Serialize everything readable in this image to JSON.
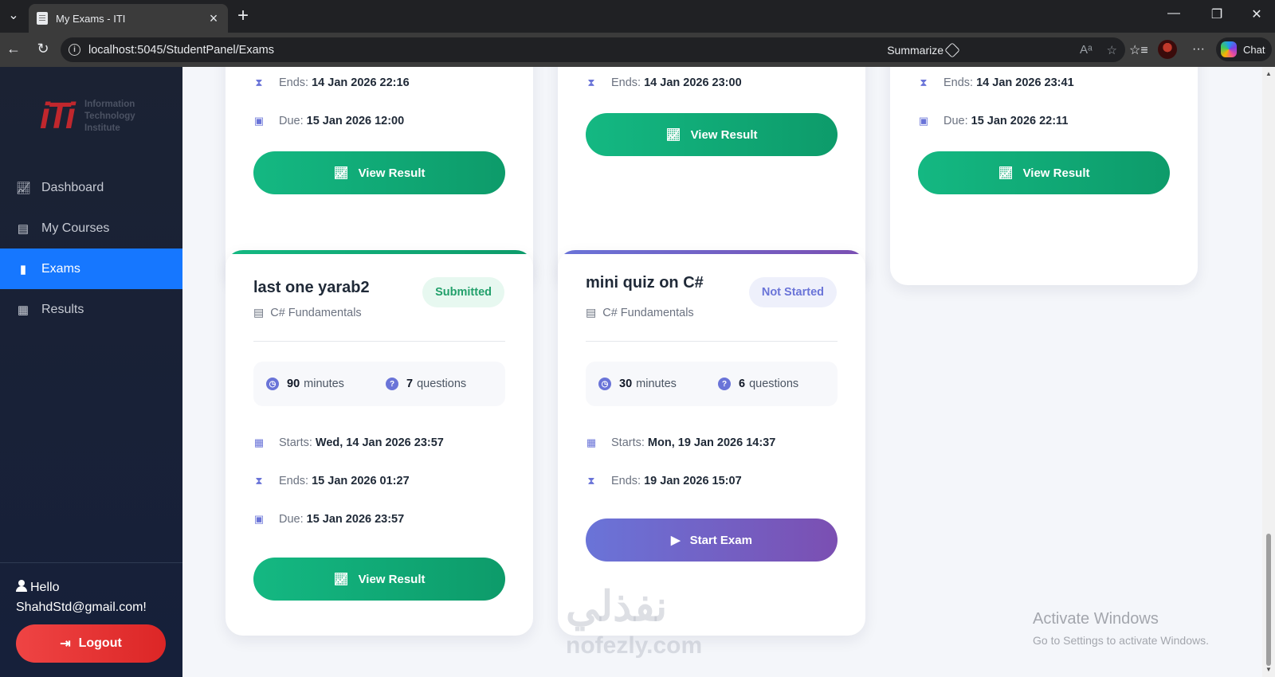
{
  "browser": {
    "tab_title": "My Exams - ITI",
    "url": "localhost:5045/StudentPanel/Exams",
    "summarize_label": "Summarize",
    "chat_label": "Chat"
  },
  "sidebar": {
    "logo_text": [
      "Information",
      "Technology",
      "Institute"
    ],
    "items": [
      {
        "label": "Dashboard",
        "icon": "chart-line-icon"
      },
      {
        "label": "My Courses",
        "icon": "book-icon"
      },
      {
        "label": "Exams",
        "icon": "file-icon",
        "active": true
      },
      {
        "label": "Results",
        "icon": "bar-chart-icon"
      }
    ],
    "greeting": "Hello",
    "email": "ShahdStd@gmail.com!",
    "logout_label": "Logout"
  },
  "top_cards": [
    {
      "ends_label": "Ends:",
      "ends": "14 Jan 2026 22:16",
      "due_label": "Due:",
      "due": "15 Jan 2026 12:00",
      "button": "View Result"
    },
    {
      "ends_label": "Ends:",
      "ends": "14 Jan 2026 23:00",
      "button": "View Result"
    },
    {
      "ends_label": "Ends:",
      "ends": "14 Jan 2026 23:41",
      "due_label": "Due:",
      "due": "15 Jan 2026 22:11",
      "button": "View Result"
    }
  ],
  "cards": [
    {
      "title": "last one yarab2",
      "course": "C# Fundamentals",
      "status": "Submitted",
      "minutes": "90",
      "minutes_label": "minutes",
      "questions": "7",
      "questions_label": "questions",
      "starts_label": "Starts:",
      "starts": "Wed, 14 Jan 2026 23:57",
      "ends_label": "Ends:",
      "ends": "15 Jan 2026 01:27",
      "due_label": "Due:",
      "due": "15 Jan 2026 23:57",
      "button": "View Result"
    },
    {
      "title": "mini quiz on C#",
      "course": "C# Fundamentals",
      "status": "Not Started",
      "minutes": "30",
      "minutes_label": "minutes",
      "questions": "6",
      "questions_label": "questions",
      "starts_label": "Starts:",
      "starts": "Mon, 19 Jan 2026 14:37",
      "ends_label": "Ends:",
      "ends": "19 Jan 2026 15:07",
      "button": "Start Exam"
    }
  ],
  "os_overlay": {
    "activate_title": "Activate Windows",
    "activate_sub": "Go to Settings to activate Windows."
  },
  "watermark": {
    "arabic": "نفذلي",
    "latin": "nofezly.com"
  },
  "colors": {
    "accent_blue": "#1677ff",
    "green": "#14b882",
    "purple": "#6a74d8",
    "logout_red": "#ef4444"
  }
}
